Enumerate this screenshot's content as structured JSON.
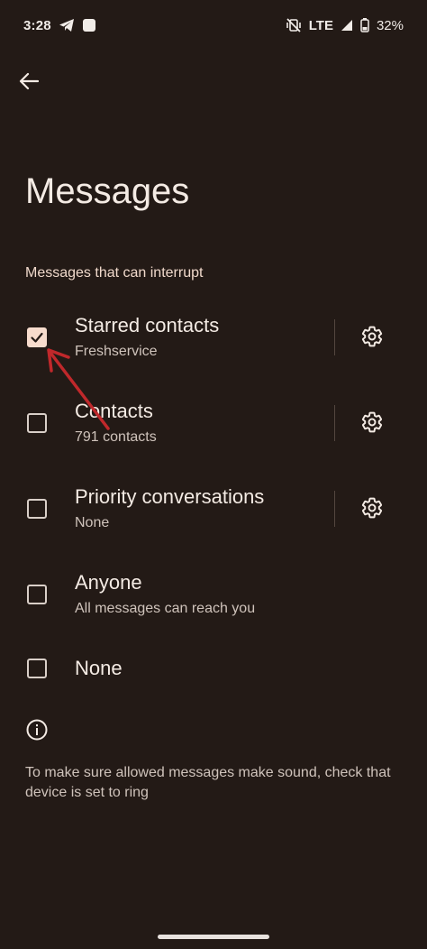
{
  "status_bar": {
    "time": "3:28",
    "network": "LTE",
    "battery": "32%",
    "icons": [
      "telegram-icon",
      "square-notification-icon",
      "vibrate-off-icon",
      "signal-icon",
      "battery-icon"
    ]
  },
  "header": {
    "back_icon": "arrow-back-icon",
    "title": "Messages"
  },
  "section": {
    "header": "Messages that can interrupt"
  },
  "options": [
    {
      "title": "Starred contacts",
      "subtitle": "Freshservice",
      "checked": true,
      "has_settings": true
    },
    {
      "title": "Contacts",
      "subtitle": "791 contacts",
      "checked": false,
      "has_settings": true
    },
    {
      "title": "Priority conversations",
      "subtitle": "None",
      "checked": false,
      "has_settings": true
    },
    {
      "title": "Anyone",
      "subtitle": "All messages can reach you",
      "checked": false,
      "has_settings": false
    },
    {
      "title": "None",
      "subtitle": "",
      "checked": false,
      "has_settings": false
    }
  ],
  "footer": {
    "info_icon": "info-icon",
    "text": "To make sure allowed messages make sound, check that device is set to ring"
  },
  "colors": {
    "background": "#231a16",
    "checkbox_checked": "#f7dccd",
    "annotation_arrow": "#c0282b"
  }
}
